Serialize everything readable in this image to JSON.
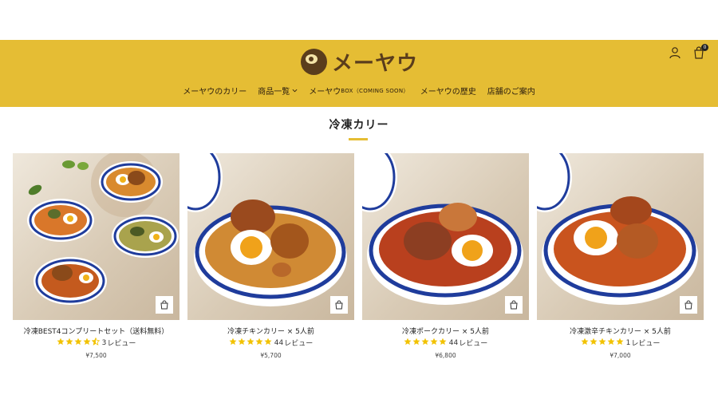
{
  "brand": {
    "name": "メーヤウ"
  },
  "header": {
    "cart_count": "0",
    "icons": [
      "account-icon",
      "cart-icon"
    ]
  },
  "nav": {
    "items": [
      {
        "label": "メーヤウのカリー"
      },
      {
        "label": "商品一覧"
      },
      {
        "label": "メーヤウ",
        "small": "BOX（COMING SOON）"
      },
      {
        "label": "メーヤウの歴史"
      },
      {
        "label": "店舗のご案内"
      }
    ]
  },
  "section": {
    "title": "冷凍カリー"
  },
  "colors": {
    "accent": "#e5bd34",
    "brand_brown": "#5a3d1c",
    "star": "#f2c200"
  },
  "products": [
    {
      "name": "冷凍BEST4コンプリートセット（送料無料）",
      "rating": 4.5,
      "count": "3",
      "reviews_label": "レビュー",
      "price": "¥7,500"
    },
    {
      "name": "冷凍チキンカリー × 5人前",
      "rating": 5,
      "count": "44",
      "reviews_label": "レビュー",
      "price": "¥5,700"
    },
    {
      "name": "冷凍ポークカリー × 5人前",
      "rating": 5,
      "count": "44",
      "reviews_label": "レビュー",
      "price": "¥6,800"
    },
    {
      "name": "冷凍激辛チキンカリー × 5人前",
      "rating": 5,
      "count": "1",
      "reviews_label": "レビュー",
      "price": "¥7,000"
    }
  ]
}
